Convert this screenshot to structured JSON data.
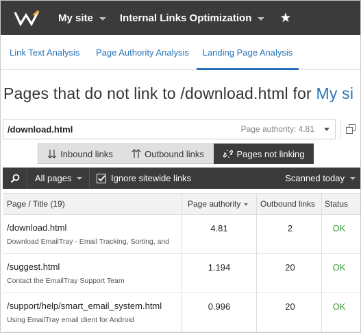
{
  "topbar": {
    "site_label": "My site",
    "tool_label": "Internal Links Optimization",
    "star_icon": "star-icon",
    "logo_icon": "w-logo"
  },
  "tabs": [
    {
      "label": "Link Text Analysis",
      "active": false
    },
    {
      "label": "Page Authority Analysis",
      "active": false
    },
    {
      "label": "Landing Page Analysis",
      "active": true
    }
  ],
  "heading": {
    "text": "Pages that do not link to /download.html for ",
    "site_link": "My si"
  },
  "url_selector": {
    "value": "/download.html",
    "page_authority": "Page authority: 4.81"
  },
  "segments": {
    "inbound": "Inbound links",
    "outbound": "Outbound links",
    "not_linking": "Pages not linking",
    "active": "not_linking"
  },
  "filterbar": {
    "all_pages": "All pages",
    "ignore_sitewide": "Ignore sitewide links",
    "ignore_checked": true,
    "scanned": "Scanned today"
  },
  "table": {
    "headers": {
      "page": "Page / Title (19)",
      "pa": "Page authority",
      "outbound": "Outbound links",
      "status": "Status"
    },
    "rows": [
      {
        "url": "/download.html",
        "title": "Download EmailTray - Email Tracking, Sorting, and",
        "pa": "4.81",
        "outbound": "2",
        "status": "OK"
      },
      {
        "url": "/suggest.html",
        "title": "Contact the EmailTray Support Team",
        "pa": "1.194",
        "outbound": "20",
        "status": "OK"
      },
      {
        "url": "/support/help/smart_email_system.html",
        "title": "Using EmailTray email client for Android",
        "pa": "0.996",
        "outbound": "20",
        "status": "OK"
      }
    ]
  },
  "colors": {
    "dark": "#3b3b3b",
    "accent": "#2a73b8",
    "ok": "#3a9a3a"
  }
}
